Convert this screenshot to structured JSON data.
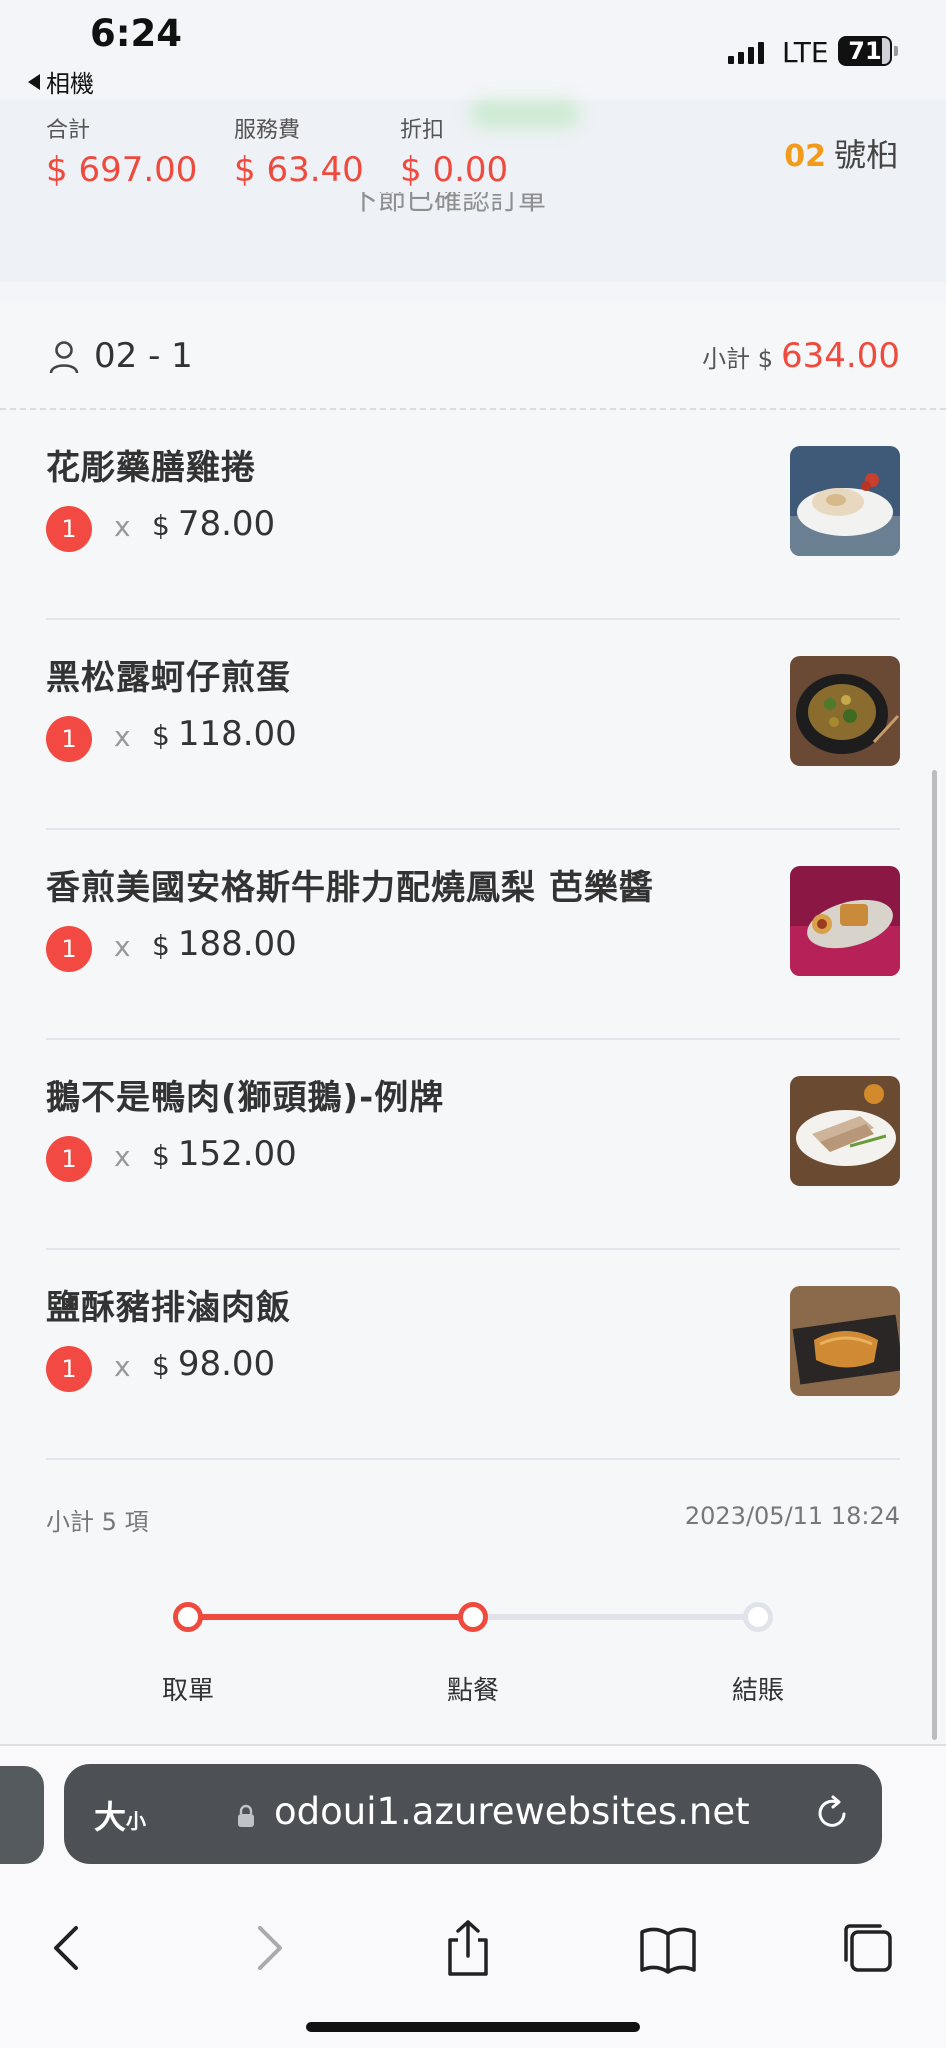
{
  "status": {
    "time": "6:24",
    "back_app": "相機",
    "network": "LTE",
    "battery": "71"
  },
  "summary": {
    "total_label": "合計",
    "total": "$ 697.00",
    "service_label": "服務費",
    "service": "$ 63.40",
    "discount_label": "折扣",
    "discount": "$ 0.00",
    "table_number": "02",
    "table_suffix": "號桕",
    "ghost_text": "下節已確認訂單"
  },
  "order": {
    "guest": "02 - 1",
    "subtotal_label": "小計 $",
    "subtotal": "634.00",
    "items": [
      {
        "name": "花彫藥膳雞捲",
        "qty": "1",
        "x": "x",
        "currency": "$",
        "price": "78.00"
      },
      {
        "name": "黑松露蚵仔煎蛋",
        "qty": "1",
        "x": "x",
        "currency": "$",
        "price": "118.00"
      },
      {
        "name": "香煎美國安格斯牛腓力配燒鳳梨 芭樂醬",
        "qty": "1",
        "x": "x",
        "currency": "$",
        "price": "188.00"
      },
      {
        "name": "鵝不是鴨肉(獅頭鵝)-例牌",
        "qty": "1",
        "x": "x",
        "currency": "$",
        "price": "152.00"
      },
      {
        "name": "鹽酥豬排滷肉飯",
        "qty": "1",
        "x": "x",
        "currency": "$",
        "price": "98.00"
      }
    ],
    "footer_count": "小計 5 項",
    "footer_time": "2023/05/11 18:24"
  },
  "progress": {
    "steps": [
      "取單",
      "點餐",
      "結賬"
    ],
    "completed_fraction": 0.5
  },
  "browser": {
    "text_size": "大",
    "text_size_small": "小",
    "url": "odoui1.azurewebsites.net"
  },
  "colors": {
    "accent": "#ef4a3e",
    "table_number": "#f29a1a"
  }
}
